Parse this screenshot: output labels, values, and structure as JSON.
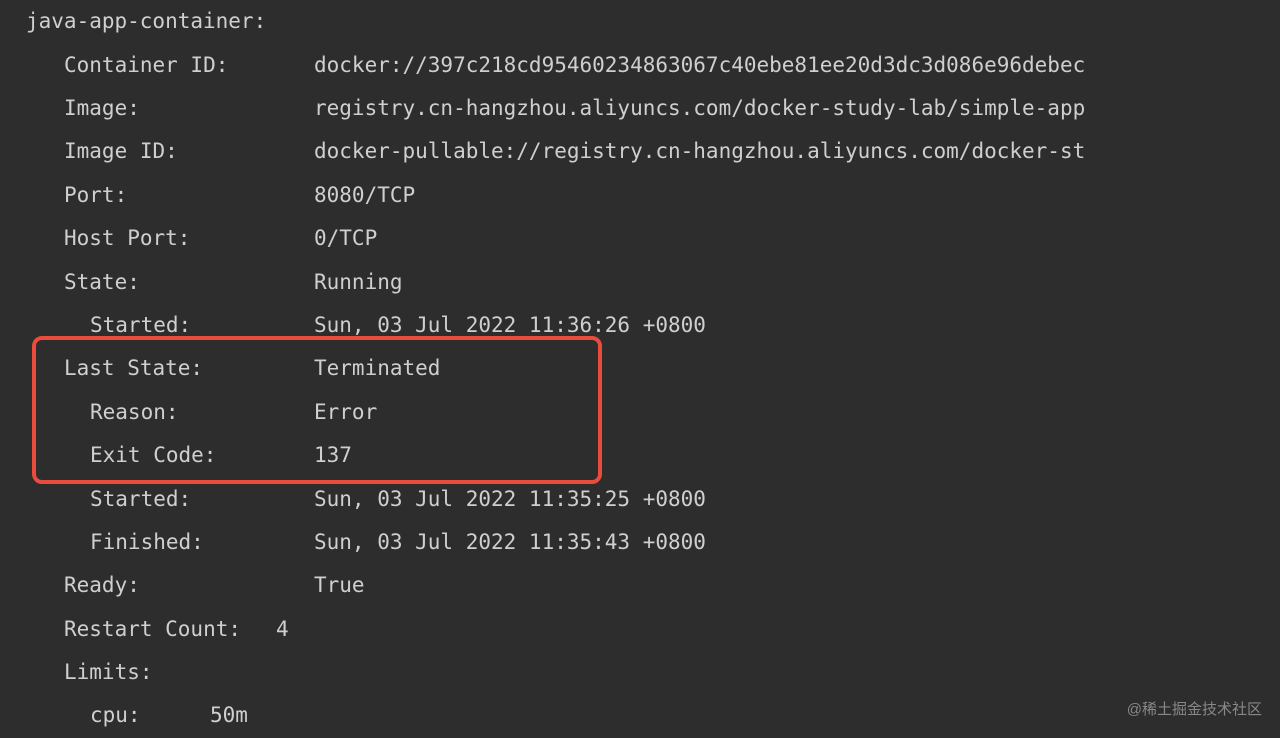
{
  "container": {
    "name": "java-app-container:",
    "fields": {
      "container_id": {
        "label": "Container ID:",
        "value": "docker://397c218cd95460234863067c40ebe81ee20d3dc3d086e96debec"
      },
      "image": {
        "label": "Image:",
        "value": "registry.cn-hangzhou.aliyuncs.com/docker-study-lab/simple-app"
      },
      "image_id": {
        "label": "Image ID:",
        "value": "docker-pullable://registry.cn-hangzhou.aliyuncs.com/docker-st"
      },
      "port": {
        "label": "Port:",
        "value": "8080/TCP"
      },
      "host_port": {
        "label": "Host Port:",
        "value": "0/TCP"
      },
      "state": {
        "label": "State:",
        "value": "Running"
      },
      "state_started": {
        "label": "Started:",
        "value": "Sun, 03 Jul 2022 11:36:26 +0800"
      },
      "last_state": {
        "label": "Last State:",
        "value": "Terminated"
      },
      "reason": {
        "label": "Reason:",
        "value": "Error"
      },
      "exit_code": {
        "label": "Exit Code:",
        "value": "137"
      },
      "last_started": {
        "label": "Started:",
        "value": "Sun, 03 Jul 2022 11:35:25 +0800"
      },
      "finished": {
        "label": "Finished:",
        "value": "Sun, 03 Jul 2022 11:35:43 +0800"
      },
      "ready": {
        "label": "Ready:",
        "value": "True"
      },
      "restart_count": {
        "label": "Restart Count:",
        "value": "4"
      },
      "limits": {
        "label": "Limits:",
        "value": ""
      },
      "cpu": {
        "label": "cpu:",
        "value": "50m"
      }
    }
  },
  "watermark": "@稀土掘金技术社区"
}
